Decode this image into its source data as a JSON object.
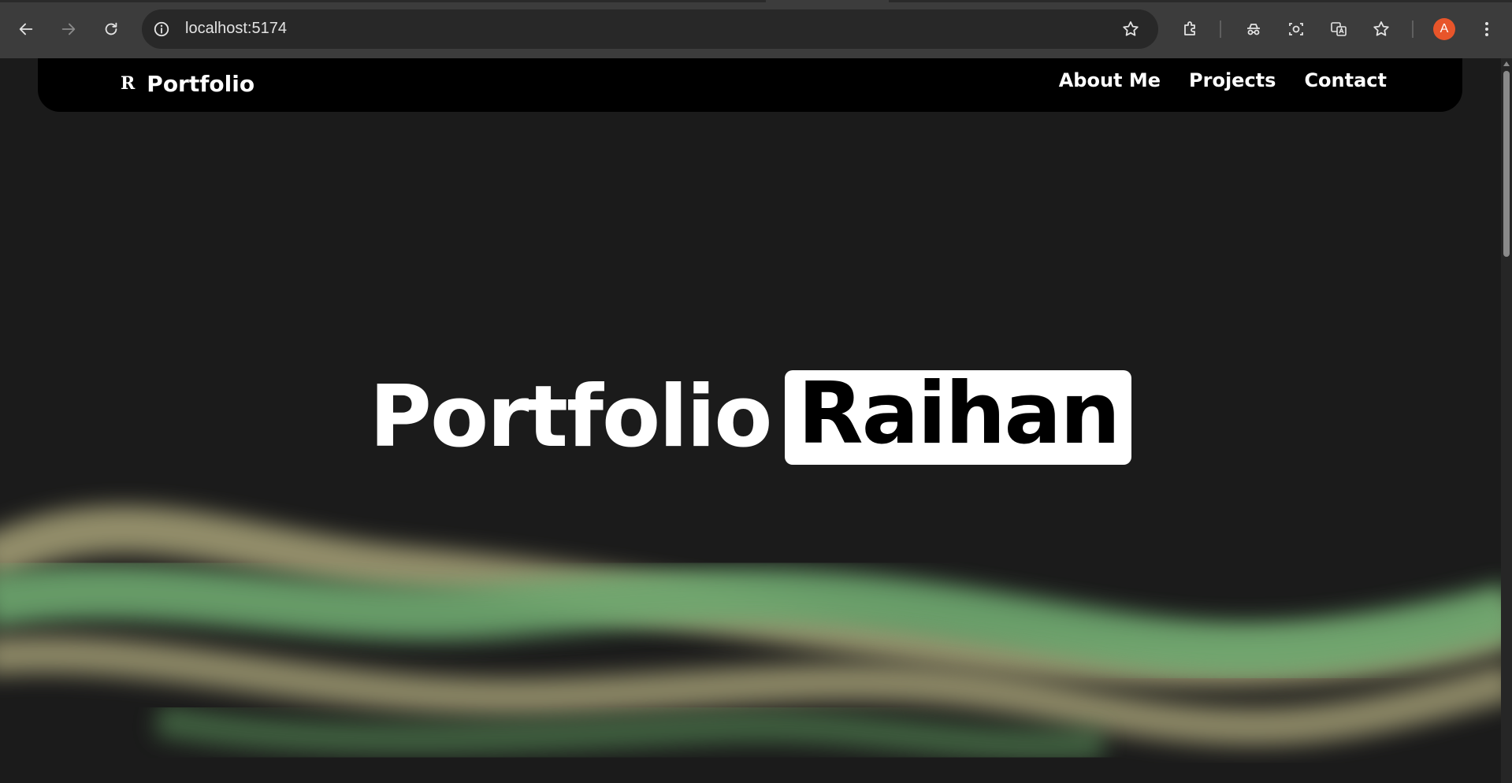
{
  "browser": {
    "url": "localhost:5174",
    "icons": {
      "back": "arrow-left-icon",
      "forward": "arrow-right-icon",
      "reload": "reload-icon",
      "site_info": "info-icon",
      "bookmark": "star-icon",
      "extensions": "puzzle-icon",
      "incognito": "incognito-icon",
      "lens": "camera-search-icon",
      "translate": "translate-icon",
      "bookmarks_star": "star-plus-icon",
      "menu": "kebab-menu-icon"
    },
    "profile_initial": "A",
    "profile_color": "#e8552a"
  },
  "site": {
    "logo_mark": "R",
    "brand_name": "Portfolio",
    "nav": {
      "items": [
        {
          "label": "About Me"
        },
        {
          "label": "Projects"
        },
        {
          "label": "Contact"
        }
      ]
    },
    "hero": {
      "word1": "Portfolio",
      "word2": "Raihan"
    },
    "colors": {
      "background": "#1b1b1b",
      "navbar": "#000000",
      "wave_green": "#6ea870",
      "wave_tan": "#a7a278"
    }
  }
}
